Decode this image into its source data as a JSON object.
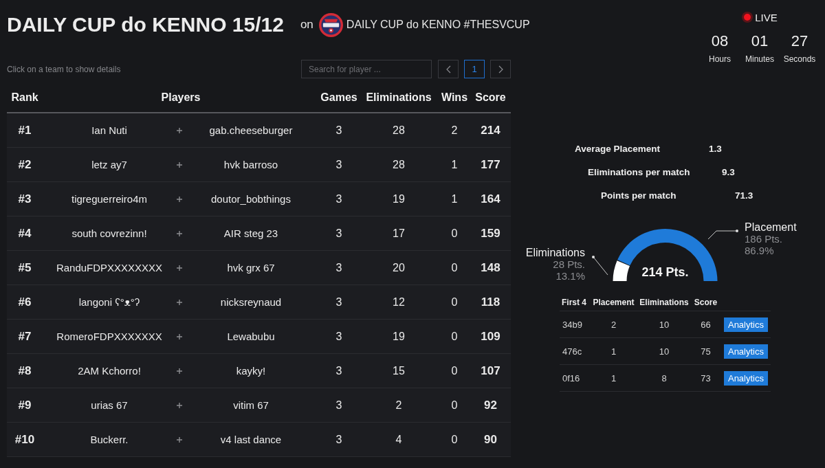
{
  "header": {
    "title": "DAILY CUP do KENNO 15/12",
    "on_label": "on",
    "organizer": "DAILY CUP do KENNO #THESVCUP"
  },
  "live": {
    "label": "LIVE"
  },
  "countdown": [
    {
      "value": "08",
      "unit": "Hours"
    },
    {
      "value": "01",
      "unit": "Minutes"
    },
    {
      "value": "27",
      "unit": "Seconds"
    }
  ],
  "toolbar": {
    "hint": "Click on a team to show details",
    "search": {
      "placeholder": "Search for player ..."
    },
    "pages": [
      {
        "label": "1",
        "selected": true
      }
    ]
  },
  "table": {
    "columns": [
      "Rank",
      "Players",
      "Games",
      "Eliminations",
      "Wins",
      "Score"
    ],
    "rows": [
      {
        "rank": "#1",
        "players": [
          "Ian Nuti",
          "gab.cheeseburger"
        ],
        "games": "3",
        "eliminations": "28",
        "wins": "2",
        "score": "214"
      },
      {
        "rank": "#2",
        "players": [
          "letz ay7",
          "hvk barroso"
        ],
        "games": "3",
        "eliminations": "28",
        "wins": "1",
        "score": "177"
      },
      {
        "rank": "#3",
        "players": [
          "tigreguerreiro4m",
          "doutor_bobthings"
        ],
        "games": "3",
        "eliminations": "19",
        "wins": "1",
        "score": "164"
      },
      {
        "rank": "#4",
        "players": [
          "south covrezinn!",
          "AIR steg 23"
        ],
        "games": "3",
        "eliminations": "17",
        "wins": "0",
        "score": "159"
      },
      {
        "rank": "#5",
        "players": [
          "RanduFDPXXXXXXXX",
          "hvk grx 67"
        ],
        "games": "3",
        "eliminations": "20",
        "wins": "0",
        "score": "148"
      },
      {
        "rank": "#6",
        "players": [
          "langoni ʕ°ᴥ°ʔ",
          "nicksreynaud"
        ],
        "games": "3",
        "eliminations": "12",
        "wins": "0",
        "score": "118"
      },
      {
        "rank": "#7",
        "players": [
          "RomeroFDPXXXXXXX",
          "Lewabubu"
        ],
        "games": "3",
        "eliminations": "19",
        "wins": "0",
        "score": "109"
      },
      {
        "rank": "#8",
        "players": [
          "2AM Kchorro!",
          "kayky!"
        ],
        "games": "3",
        "eliminations": "15",
        "wins": "0",
        "score": "107"
      },
      {
        "rank": "#9",
        "players": [
          "urias 67",
          "vitim 67"
        ],
        "games": "3",
        "eliminations": "2",
        "wins": "0",
        "score": "92"
      },
      {
        "rank": "#10",
        "players": [
          "Buckerr.",
          "v4 last dance"
        ],
        "games": "3",
        "eliminations": "4",
        "wins": "0",
        "score": "90"
      }
    ]
  },
  "summary": {
    "stats": [
      {
        "label": "Average Placement",
        "value": "1.3"
      },
      {
        "label": "Eliminations per match",
        "value": "9.3"
      },
      {
        "label": "Points per match",
        "value": "71.3"
      }
    ],
    "chart_data": [
      {
        "type": "donut",
        "categories": [
          "Eliminations",
          "Placement"
        ],
        "values": [
          28,
          186
        ],
        "colors": [
          "#ffffff",
          "#1f7bd9"
        ],
        "value_labels": [
          "28 Pts.",
          "186 Pts."
        ],
        "annotations": [
          "214 Pts.",
          "13.1%",
          "86.9%"
        ]
      }
    ],
    "matches": {
      "columns": [
        "First 4",
        "Placement",
        "Eliminations",
        "Score"
      ],
      "rows": [
        {
          "first_4": "34b9",
          "placement": "2",
          "eliminations": "10",
          "score": "66",
          "action": "Analytics"
        },
        {
          "first_4": "476c",
          "placement": "1",
          "eliminations": "10",
          "score": "75",
          "action": "Analytics"
        },
        {
          "first_4": "0f16",
          "placement": "1",
          "eliminations": "8",
          "score": "73",
          "action": "Analytics"
        }
      ]
    }
  }
}
